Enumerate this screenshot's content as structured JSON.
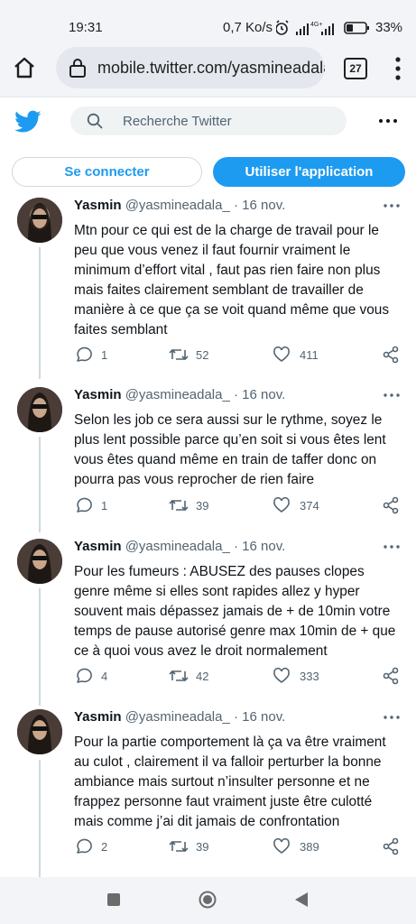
{
  "status_bar": {
    "time": "19:31",
    "speed": "0,7 Ko/s",
    "battery": "33%"
  },
  "browser": {
    "url": "mobile.twitter.com/yasmineadala",
    "tab_count": "27"
  },
  "header": {
    "search_placeholder": "Recherche Twitter"
  },
  "auth": {
    "login_label": "Se connecter",
    "app_label": "Utiliser l'application"
  },
  "colors": {
    "accent": "#1d9bf0",
    "text": "#0f1419",
    "secondary": "#536471"
  },
  "tweets": [
    {
      "name": "Yasmin",
      "handle": "@yasmineadala_",
      "date": "· 16 nov.",
      "text": "Mtn pour ce qui est de la charge de travail pour le peu que vous venez il faut fournir vraiment le minimum d’effort vital , faut pas rien faire non plus mais faites clairement semblant de travailler de manière à ce que ça se voit quand même que vous faites semblant",
      "replies": "1",
      "retweets": "52",
      "likes": "411"
    },
    {
      "name": "Yasmin",
      "handle": "@yasmineadala_",
      "date": "· 16 nov.",
      "text": "Selon les job ce sera aussi sur le rythme, soyez le plus lent possible parce qu’en soit si vous êtes lent vous êtes quand même en train de taffer donc on pourra pas vous reprocher de rien faire",
      "replies": "1",
      "retweets": "39",
      "likes": "374"
    },
    {
      "name": "Yasmin",
      "handle": "@yasmineadala_",
      "date": "· 16 nov.",
      "text": "Pour les fumeurs : ABUSEZ des pauses clopes genre même si elles sont rapides allez y hyper souvent mais dépassez jamais de + de 10min votre temps de pause autorisé genre max 10min de + que ce à quoi vous avez le droit normalement",
      "replies": "4",
      "retweets": "42",
      "likes": "333"
    },
    {
      "name": "Yasmin",
      "handle": "@yasmineadala_",
      "date": "· 16 nov.",
      "text": "Pour la partie comportement là ça va être vraiment au culot , clairement il va falloir perturber la bonne ambiance mais surtout n’insulter personne et ne frappez personne faut vraiment juste être culotté mais comme j’ai dit jamais de confrontation",
      "replies": "2",
      "retweets": "39",
      "likes": "389"
    }
  ]
}
